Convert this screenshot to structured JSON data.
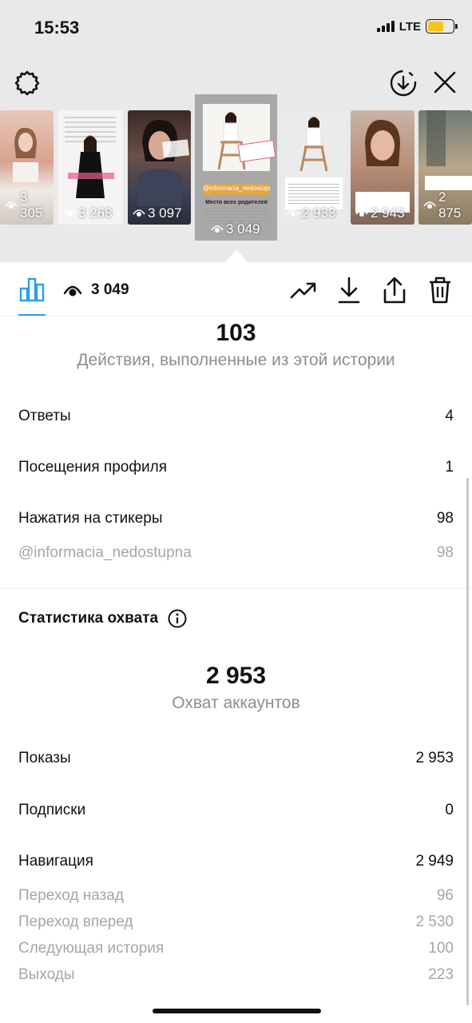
{
  "status_bar": {
    "time": "15:53",
    "network": "LTE"
  },
  "stories": [
    {
      "views": "3 305"
    },
    {
      "views": "3 268",
      "caption": "@INFORMACIA_NEDOSTUPNA"
    },
    {
      "views": "3 097"
    },
    {
      "views": "3 049",
      "mention": "@informacia_nedostupna",
      "sticker": "О родительском чате...",
      "heading": "Место всех родителей"
    },
    {
      "views": "2 933",
      "mention": "@informacia_nedostupna"
    },
    {
      "views": "2 943"
    },
    {
      "views": "2 875"
    }
  ],
  "toolbar": {
    "views": "3 049"
  },
  "actions": {
    "total": "103",
    "caption": "Действия, выполненные из этой истории",
    "rows": [
      {
        "label": "Ответы",
        "value": "4"
      },
      {
        "label": "Посещения профиля",
        "value": "1"
      },
      {
        "label": "Нажатия на стикеры",
        "value": "98"
      },
      {
        "label": "@informacia_nedostupna",
        "value": "98"
      }
    ]
  },
  "reach": {
    "title": "Статистика охвата",
    "total": "2 953",
    "caption": "Охват аккаунтов",
    "rows": [
      {
        "label": "Показы",
        "value": "2 953"
      },
      {
        "label": "Подписки",
        "value": "0"
      },
      {
        "label": "Навигация",
        "value": "2 949"
      },
      {
        "label": "Переход назад",
        "value": "96"
      },
      {
        "label": "Переход вперед",
        "value": "2 530"
      },
      {
        "label": "Следующая история",
        "value": "100"
      },
      {
        "label": "Выходы",
        "value": "223"
      }
    ]
  },
  "colors": {
    "accent": "#2a9df4",
    "battery": "#f5c518",
    "background_top": "#e9e9e9"
  }
}
